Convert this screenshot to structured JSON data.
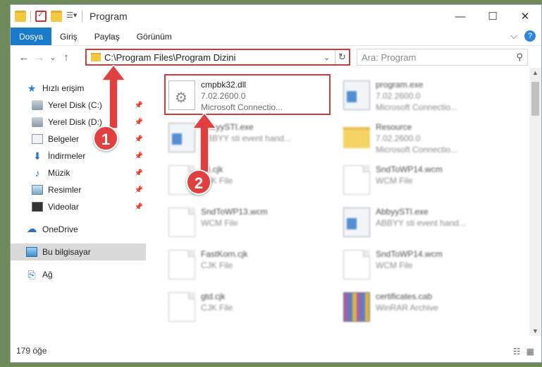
{
  "window": {
    "title": "Program",
    "controls": {
      "minimize": "—",
      "maximize": "☐",
      "close": "✕"
    }
  },
  "ribbon": {
    "tabs": [
      "Dosya",
      "Giriş",
      "Paylaş",
      "Görünüm"
    ],
    "expand_glyph": "⌵",
    "help_glyph": "?"
  },
  "navigation": {
    "back": "←",
    "forward": "→",
    "recent": "⌄",
    "up": "↑",
    "path": "C:\\Program Files\\Program Dizini",
    "search_placeholder": "Ara: Program"
  },
  "sidebar": {
    "items": [
      {
        "label": "Hızlı erişim",
        "icon": "star-icon",
        "pinned": false
      },
      {
        "label": "Yerel Disk (C:)",
        "icon": "drive-icon",
        "pinned": true
      },
      {
        "label": "Yerel Disk (D:)",
        "icon": "drive-icon",
        "pinned": true
      },
      {
        "label": "Belgeler",
        "icon": "documents-icon",
        "pinned": true
      },
      {
        "label": "İndirmeler",
        "icon": "downloads-icon",
        "pinned": true
      },
      {
        "label": "Müzik",
        "icon": "music-icon",
        "pinned": true
      },
      {
        "label": "Resimler",
        "icon": "pictures-icon",
        "pinned": true
      },
      {
        "label": "Videolar",
        "icon": "videos-icon",
        "pinned": true
      },
      {
        "label": "OneDrive",
        "icon": "onedrive-icon",
        "pinned": false
      },
      {
        "label": "Bu bilgisayar",
        "icon": "computer-icon",
        "pinned": false,
        "selected": true
      },
      {
        "label": "Ağ",
        "icon": "network-icon",
        "pinned": false
      }
    ]
  },
  "files": [
    {
      "name": "cmpbk32.dll",
      "line2": "7.02.2600.0",
      "line3": "Microsoft Connectio...",
      "icon": "dll-gear-icon",
      "highlighted": true
    },
    {
      "name": "program.exe",
      "line2": "7.02.2600.0",
      "line3": "Microsoft Connectio...",
      "icon": "exe-icon"
    },
    {
      "name": "AbbyySTI.exe",
      "line2": "ABBYY sti event hand...",
      "line3": "",
      "icon": "exe-icon"
    },
    {
      "name": "Resource",
      "line2": "7.02.2600.0",
      "line3": "Microsoft Connectio...",
      "icon": "folder-icon"
    },
    {
      "name": "ftd.cjk",
      "line2": "CJK File",
      "line3": "",
      "icon": "file-icon"
    },
    {
      "name": "SndToWP14.wcm",
      "line2": "WCM File",
      "line3": "",
      "icon": "file-icon"
    },
    {
      "name": "SndToWP13.wcm",
      "line2": "WCM File",
      "line3": "",
      "icon": "file-icon"
    },
    {
      "name": "AbbyySTI.exe",
      "line2": "ABBYY sti event hand...",
      "line3": "",
      "icon": "exe-icon"
    },
    {
      "name": "FastKorn.cjk",
      "line2": "CJK File",
      "line3": "",
      "icon": "file-icon"
    },
    {
      "name": "SndToWP14.wcm",
      "line2": "WCM File",
      "line3": "",
      "icon": "file-icon"
    },
    {
      "name": "gtd.cjk",
      "line2": "CJK File",
      "line3": "",
      "icon": "file-icon"
    },
    {
      "name": "certificates.cab",
      "line2": "WinRAR Archive",
      "line3": "",
      "icon": "archive-icon"
    }
  ],
  "status": {
    "item_count": "179 öğe"
  },
  "annotations": [
    {
      "number": "1"
    },
    {
      "number": "2"
    }
  ],
  "colors": {
    "accent": "#1979ca",
    "highlight": "#d33b3b",
    "marker": "#e04040"
  }
}
